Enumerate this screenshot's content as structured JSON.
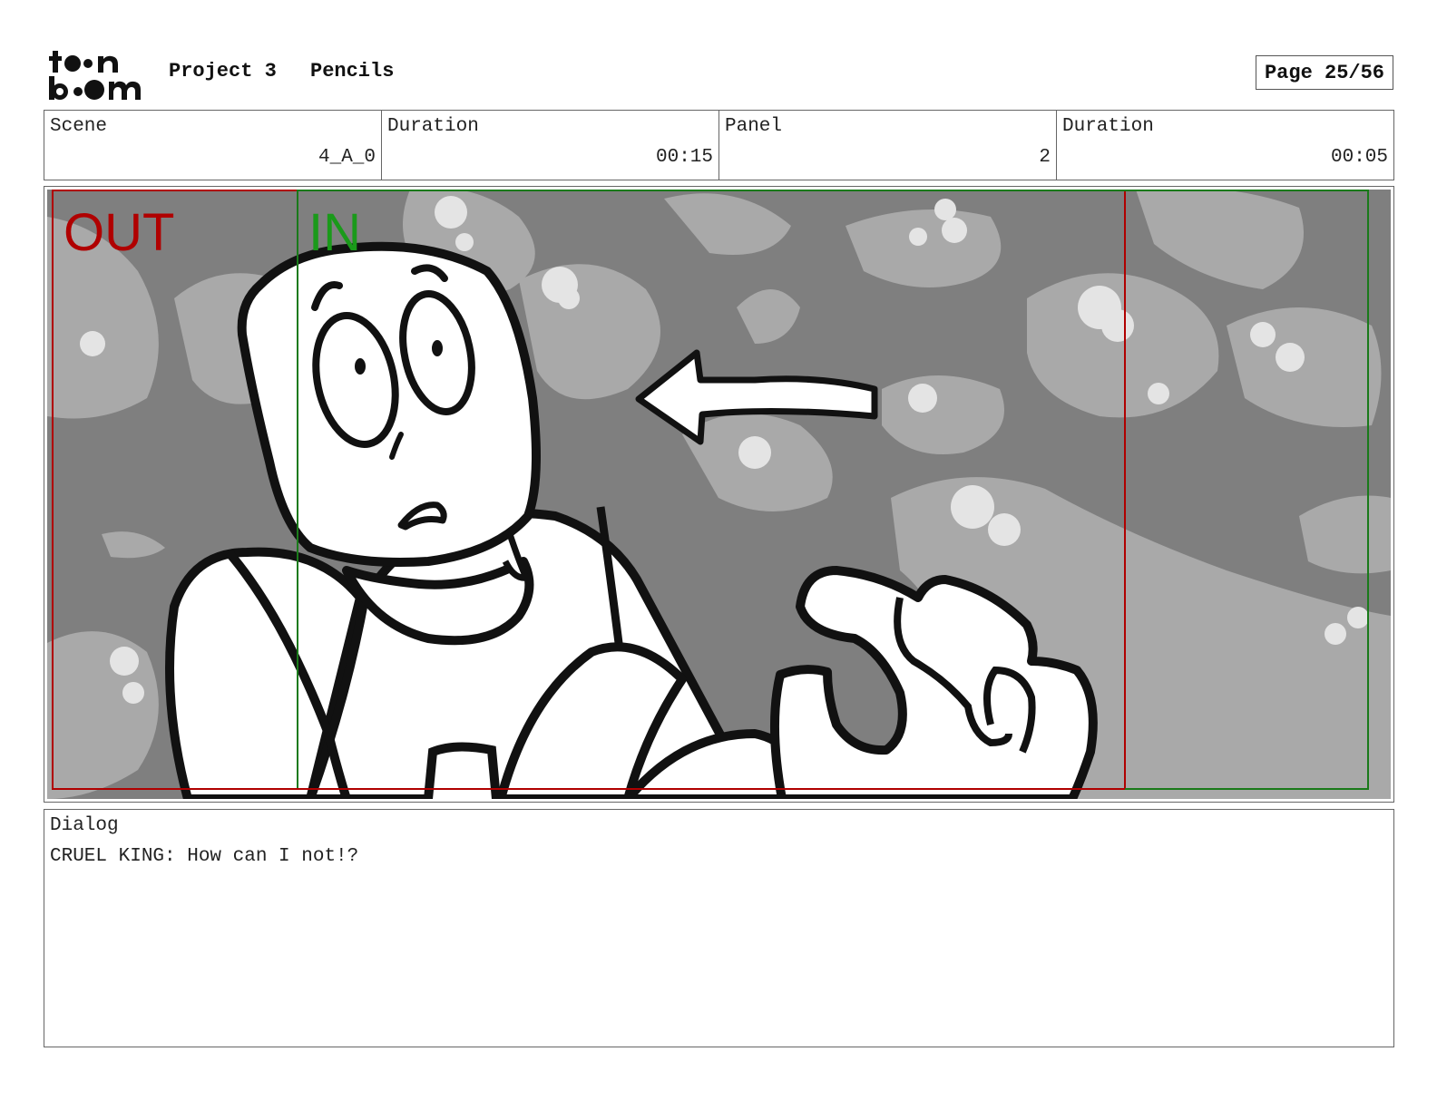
{
  "header": {
    "logo_text": "toon boom",
    "project_name": "Project 3",
    "stage": "Pencils",
    "page": "Page 25/56"
  },
  "info": {
    "scene_label": "Scene",
    "scene_value": "4_A_0",
    "scene_duration_label": "Duration",
    "scene_duration_value": "00:15",
    "panel_label": "Panel",
    "panel_value": "2",
    "panel_duration_label": "Duration",
    "panel_duration_value": "00:05"
  },
  "frame": {
    "out_label": "OUT",
    "in_label": "IN",
    "out_color": "#b00000",
    "in_color": "#1a9a1a"
  },
  "dialog": {
    "label": "Dialog",
    "text": "CRUEL KING: How can I not!?"
  }
}
